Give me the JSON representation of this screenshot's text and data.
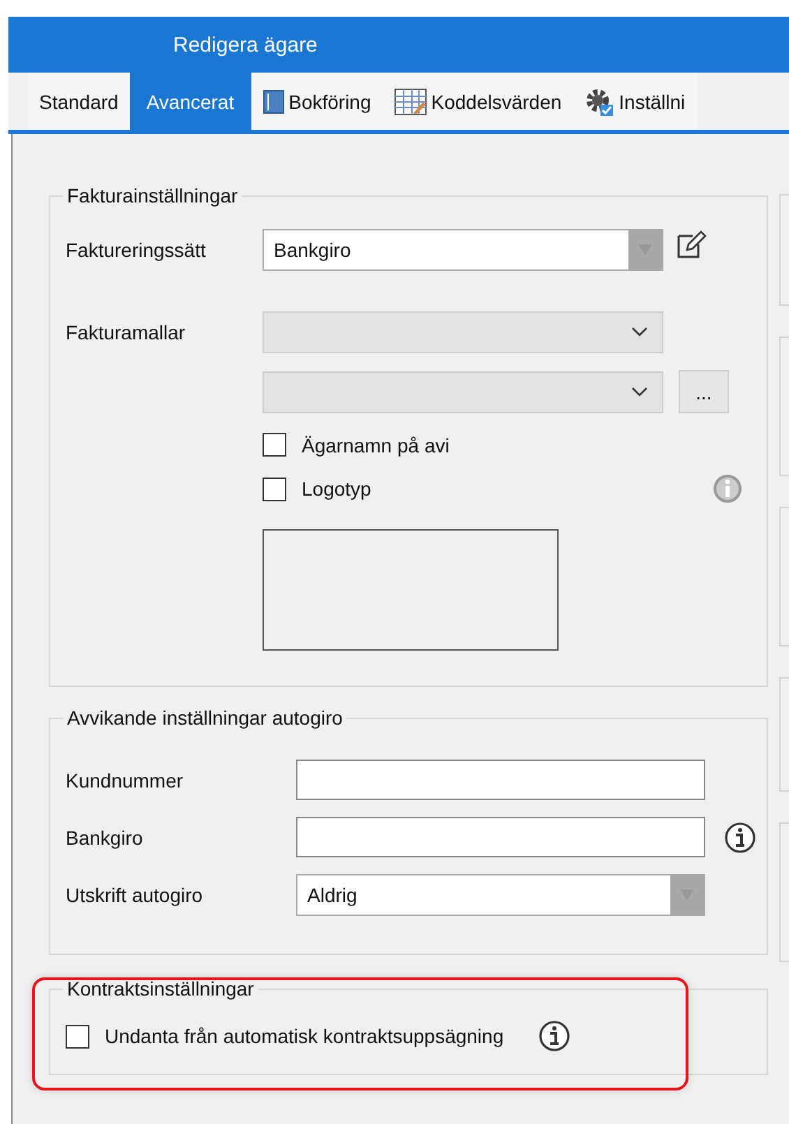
{
  "window": {
    "title": "Redigera ägare"
  },
  "tabs": [
    {
      "label": "Standard",
      "kind": "plain",
      "selected": false
    },
    {
      "label": "Avancerat",
      "kind": "plain",
      "selected": true
    },
    {
      "label": "Bokföring",
      "kind": "book",
      "selected": false
    },
    {
      "label": "Koddelsvärden",
      "kind": "grid",
      "selected": false
    },
    {
      "label": "Inställni",
      "kind": "gear",
      "selected": false
    }
  ],
  "invoice_settings": {
    "title": "Fakturainställningar",
    "method_label": "Faktureringssätt",
    "method_value": "Bankgiro",
    "templates_label": "Fakturamallar",
    "browse_button": "...",
    "checkboxes": [
      {
        "label": "Ägarnamn på avi",
        "checked": false
      },
      {
        "label": "Logotyp",
        "checked": false
      }
    ]
  },
  "autogiro": {
    "title": "Avvikande inställningar autogiro",
    "customer_number_label": "Kundnummer",
    "bankgiro_label": "Bankgiro",
    "print_label": "Utskrift autogiro",
    "print_value": "Aldrig"
  },
  "contract": {
    "title": "Kontraktsinställningar",
    "checkbox": {
      "label": "Undanta från automatisk kontraktsuppsägning",
      "checked": false
    }
  }
}
